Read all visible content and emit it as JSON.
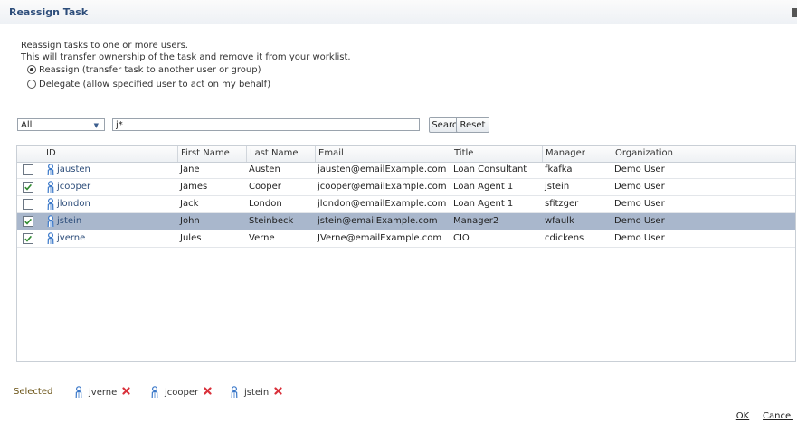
{
  "dialog": {
    "title": "Reassign Task"
  },
  "description": {
    "line1": "Reassign tasks to one or more users.",
    "line2": "This will transfer ownership of the task and remove it from your worklist."
  },
  "options": {
    "reassign_label": "Reassign (transfer task to another user or group)",
    "delegate_label": "Delegate (allow specified user to act on my behalf)",
    "selected": "reassign"
  },
  "filter": {
    "select_value": "All",
    "search_value": "j*",
    "search_label": "Search",
    "reset_label": "Reset"
  },
  "table": {
    "columns": [
      "ID",
      "First Name",
      "Last Name",
      "Email",
      "Title",
      "Manager",
      "Organization"
    ],
    "rows": [
      {
        "checked": false,
        "selected": false,
        "id": "jausten",
        "first": "Jane",
        "last": "Austen",
        "email": "jausten@emailExample.com",
        "title": "Loan Consultant",
        "manager": "fkafka",
        "org": "Demo User"
      },
      {
        "checked": true,
        "selected": false,
        "id": "jcooper",
        "first": "James",
        "last": "Cooper",
        "email": "jcooper@emailExample.com",
        "title": "Loan Agent 1",
        "manager": "jstein",
        "org": "Demo User"
      },
      {
        "checked": false,
        "selected": false,
        "id": "jlondon",
        "first": "Jack",
        "last": "London",
        "email": "jlondon@emailExample.com",
        "title": "Loan Agent 1",
        "manager": "sfitzger",
        "org": "Demo User"
      },
      {
        "checked": true,
        "selected": true,
        "id": "jstein",
        "first": "John",
        "last": "Steinbeck",
        "email": "jstein@emailExample.com",
        "title": "Manager2",
        "manager": "wfaulk",
        "org": "Demo User"
      },
      {
        "checked": true,
        "selected": false,
        "id": "jverne",
        "first": "Jules",
        "last": "Verne",
        "email": "JVerne@emailExample.com",
        "title": "CIO",
        "manager": "cdickens",
        "org": "Demo User"
      }
    ]
  },
  "selected": {
    "label": "Selected",
    "users": [
      "jverne",
      "jcooper",
      "jstein"
    ]
  },
  "footer": {
    "ok_label": "OK",
    "cancel_label": "Cancel"
  },
  "colors": {
    "title": "#2d4d7a",
    "selected_row": "#a9b7cc",
    "remove_icon": "#d9303a",
    "user_icon": "#3a78c9"
  }
}
